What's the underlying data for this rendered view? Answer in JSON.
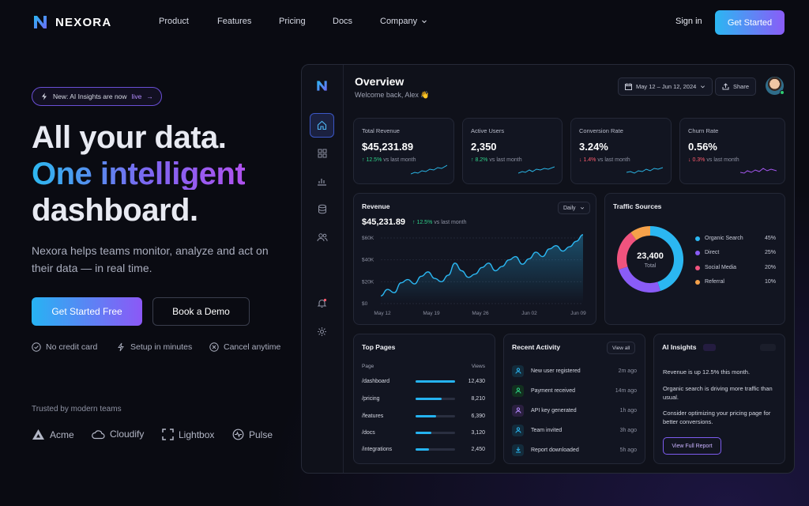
{
  "brand": {
    "name": "NEXORA"
  },
  "nav": {
    "items": [
      "Product",
      "Features",
      "Pricing",
      "Docs",
      "Company"
    ],
    "signin": "Sign in",
    "cta": "Get Started"
  },
  "hero": {
    "badge": {
      "text": "New: AI Insights are now",
      "live": "live",
      "arrow": "→"
    },
    "headline": {
      "line1": "All your data.",
      "line2": "One intelligent",
      "line3": "dashboard."
    },
    "lead": "Nexora helps teams monitor, analyze and act on their data — in real time.",
    "cta_primary": "Get Started Free",
    "cta_secondary": "Book a Demo",
    "perks": [
      "No credit card",
      "Setup in minutes",
      "Cancel anytime"
    ],
    "trusted_label": "Trusted by modern teams",
    "brands": [
      "Acme",
      "Cloudify",
      "Lightbox",
      "Pulse"
    ]
  },
  "dashboard": {
    "title": "Overview",
    "subtitle": "Welcome back, Alex 👋",
    "date_range": "May 12 – Jun 12, 2024",
    "share": "Share",
    "kpis": [
      {
        "label": "Total Revenue",
        "value": "$45,231.89",
        "delta": "12.5%",
        "dir": "up",
        "suffix": "vs last month",
        "color": "#2ab6e6"
      },
      {
        "label": "Active Users",
        "value": "2,350",
        "delta": "8.2%",
        "dir": "up",
        "suffix": "vs last month",
        "color": "#2ab6e6"
      },
      {
        "label": "Conversion Rate",
        "value": "3.24%",
        "delta": "1.4%",
        "dir": "down",
        "suffix": "vs last month",
        "color": "#2ab6e6"
      },
      {
        "label": "Churn Rate",
        "value": "0.56%",
        "delta": "0.3%",
        "dir": "down",
        "suffix": "vs last month",
        "color": "#a557f0"
      }
    ],
    "revenue": {
      "title": "Revenue",
      "value": "$45,231.89",
      "delta": "12.5%",
      "suffix": "vs last month",
      "period": "Daily"
    },
    "traffic": {
      "title": "Traffic Sources",
      "total": "23,400",
      "total_label": "Total",
      "sources": [
        {
          "name": "Organic Search",
          "pct": "45%",
          "value": 45,
          "color": "#2bb7f2"
        },
        {
          "name": "Direct",
          "pct": "25%",
          "value": 25,
          "color": "#8a5cf7"
        },
        {
          "name": "Social Media",
          "pct": "20%",
          "value": 20,
          "color": "#f0537e"
        },
        {
          "name": "Referral",
          "pct": "10%",
          "value": 10,
          "color": "#f5a14a"
        }
      ]
    },
    "top_pages": {
      "title": "Top Pages",
      "col_page": "Page",
      "col_views": "Views",
      "rows": [
        {
          "page": "/dashboard",
          "views": "12,430",
          "share": 1.0
        },
        {
          "page": "/pricing",
          "views": "8,210",
          "share": 0.66
        },
        {
          "page": "/features",
          "views": "6,390",
          "share": 0.51
        },
        {
          "page": "/docs",
          "views": "3,120",
          "share": 0.4
        },
        {
          "page": "/integrations",
          "views": "2,450",
          "share": 0.34
        }
      ]
    },
    "activity": {
      "title": "Recent Activity",
      "view_all": "View all",
      "items": [
        {
          "text": "New user registered",
          "time": "2m ago",
          "color": "#2bb7f2"
        },
        {
          "text": "Payment received",
          "time": "14m ago",
          "color": "#2fd28a"
        },
        {
          "text": "API key generated",
          "time": "1h ago",
          "color": "#b48cff"
        },
        {
          "text": "Team invited",
          "time": "3h ago",
          "color": "#2bb7f2"
        },
        {
          "text": "Report downloaded",
          "time": "5h ago",
          "color": "#2bb7f2"
        }
      ]
    },
    "ai": {
      "title": "AI Insights",
      "p1": "Revenue is up 12.5% this month.",
      "p2": "Organic search is driving more traffic than usual.",
      "p3": "Consider optimizing your pricing page for better conversions.",
      "cta": "View Full Report"
    }
  },
  "chart_data": {
    "type": "area",
    "x_ticks": [
      "May 12",
      "May 19",
      "May 26",
      "Jun 02",
      "Jun 09"
    ],
    "y_ticks": [
      "$0",
      "$20K",
      "$40K",
      "$60K"
    ],
    "ylim": [
      0,
      60000
    ],
    "series": [
      {
        "values": [
          7000,
          13000,
          10000,
          19000,
          22000,
          18000,
          25000,
          29000,
          23000,
          20000,
          26000,
          37000,
          30000,
          24000,
          27000,
          33000,
          37000,
          30000,
          34000,
          40000,
          43000,
          36000,
          41000,
          47000,
          43000,
          50000,
          53000,
          48000,
          52000,
          57000,
          63000
        ]
      }
    ]
  }
}
